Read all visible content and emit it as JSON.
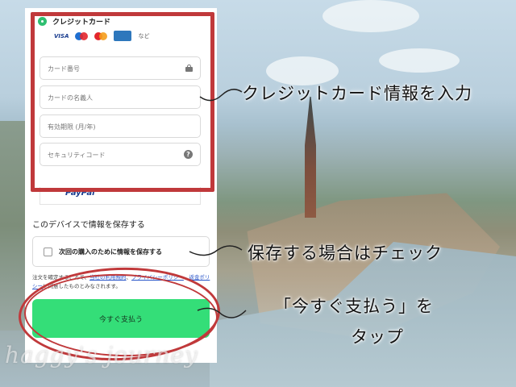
{
  "payment": {
    "credit_card_title": "クレジットカード",
    "brands": [
      "VISA",
      "など"
    ],
    "card_number_placeholder": "カード番号",
    "cardholder_placeholder": "カードの名義人",
    "expiry_placeholder": "有効期限 (月/年)",
    "security_code_placeholder": "セキュリティコード",
    "paypal_label": "PayPal",
    "save_heading": "このデバイスで情報を保存する",
    "save_checkbox_label": "次回の購入のために情報を保存する",
    "terms_prefix": "注文を確定することで、",
    "terms_link_1": "当社の利用規約",
    "terms_sep": "、",
    "terms_link_2": "プライバシーポリシー",
    "terms_mid": "、",
    "terms_link_3": "返金ポリシー",
    "terms_suffix": "に同意したものとみなされます。",
    "pay_button": "今すぐ支払う",
    "accent_color": "#34de78"
  },
  "annotations": {
    "card_info": "クレジットカード情報を入力",
    "save_check": "保存する場合はチェック",
    "tap_line1": "「今すぐ支払う」を",
    "tap_line2": "タップ",
    "highlight_color": "#c0393b"
  },
  "watermark": "haggy's journey"
}
